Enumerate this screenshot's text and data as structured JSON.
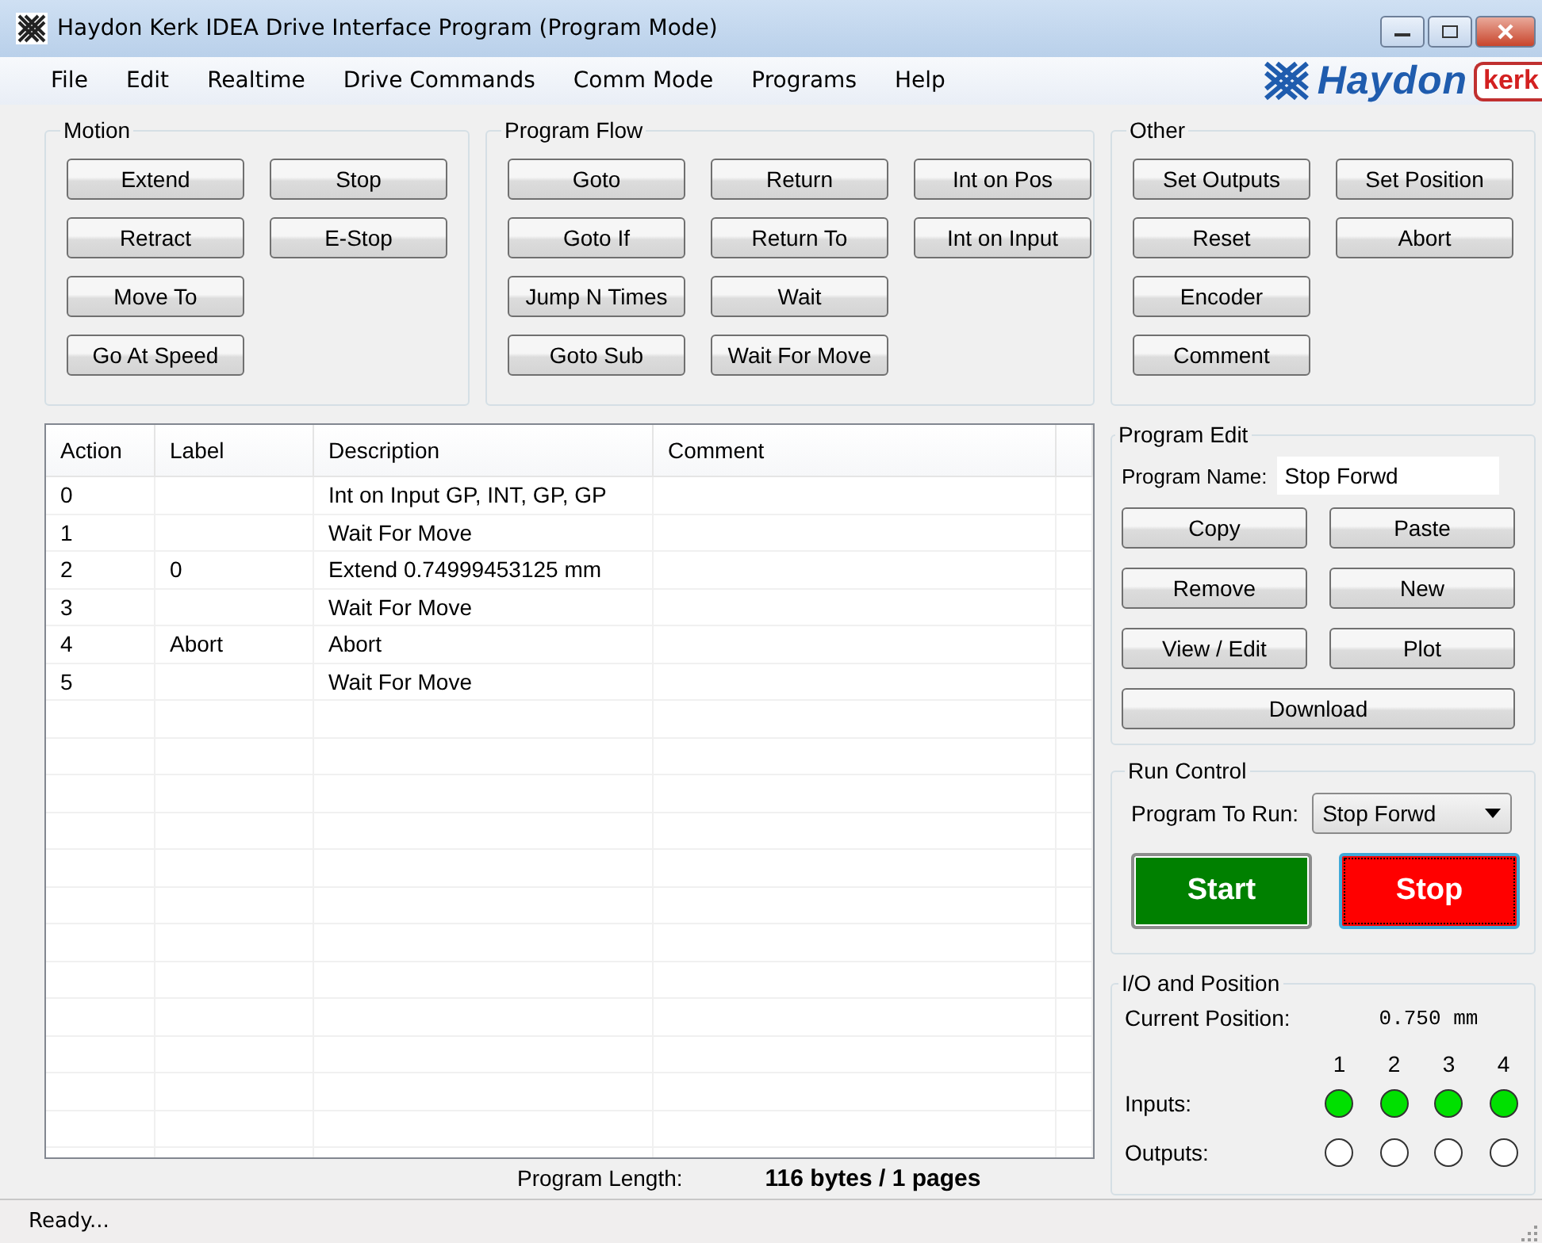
{
  "window": {
    "title": "Haydon Kerk IDEA Drive Interface Program (Program Mode)"
  },
  "menu": [
    "File",
    "Edit",
    "Realtime",
    "Drive Commands",
    "Comm Mode",
    "Programs",
    "Help"
  ],
  "logo": {
    "brand": "Haydon",
    "badge": "kerk"
  },
  "motion": {
    "title": "Motion",
    "rows": [
      [
        "Extend",
        "Stop"
      ],
      [
        "Retract",
        "E-Stop"
      ],
      [
        "Move To"
      ],
      [
        "Go At Speed"
      ]
    ]
  },
  "program_flow": {
    "title": "Program Flow",
    "rows": [
      [
        "Goto",
        "Return",
        "Int on Pos"
      ],
      [
        "Goto If",
        "Return To",
        "Int on Input"
      ],
      [
        "Jump N Times",
        "Wait"
      ],
      [
        "Goto Sub",
        "Wait For Move"
      ]
    ]
  },
  "other": {
    "title": "Other",
    "rows": [
      [
        "Set Outputs",
        "Set Position"
      ],
      [
        "Reset",
        "Abort"
      ],
      [
        "Encoder"
      ],
      [
        "Comment"
      ]
    ]
  },
  "table": {
    "columns": [
      "Action",
      "Label",
      "Description",
      "Comment"
    ],
    "rows": [
      {
        "action": "0",
        "description": "Int on Input GP, INT, GP, GP"
      },
      {
        "action": "1",
        "description": "Wait For Move"
      },
      {
        "action": "2",
        "label": "0",
        "description": "Extend 0.74999453125 mm"
      },
      {
        "action": "3",
        "description": "Wait For Move"
      },
      {
        "action": "4",
        "label": "Abort",
        "description": "Abort"
      },
      {
        "action": "5",
        "description": "Wait For Move"
      }
    ]
  },
  "program_length": {
    "label": "Program Length:",
    "value": "116 bytes / 1 pages"
  },
  "program_edit": {
    "title": "Program Edit",
    "name_label": "Program Name:",
    "name_value": "Stop Forwd",
    "rows": [
      [
        "Copy",
        "Paste"
      ],
      [
        "Remove",
        "New"
      ],
      [
        "View / Edit",
        "Plot"
      ],
      [
        "Download"
      ]
    ]
  },
  "run_control": {
    "title": "Run Control",
    "program_label": "Program To Run:",
    "program_value": "Stop Forwd",
    "buttons": [
      {
        "label": "Start",
        "kind": "start",
        "focused": false
      },
      {
        "label": "Stop",
        "kind": "stop",
        "focused": true
      }
    ]
  },
  "io": {
    "title": "I/O and Position",
    "position_label": "Current Position:",
    "position_value": "0.750 mm",
    "channels": [
      "1",
      "2",
      "3",
      "4"
    ],
    "inputs": {
      "label": "Inputs:",
      "leds": [
        {
          "on": true
        },
        {
          "on": true
        },
        {
          "on": true
        },
        {
          "on": true
        }
      ]
    },
    "outputs": {
      "label": "Outputs:",
      "leds": [
        {
          "on": false
        },
        {
          "on": false
        },
        {
          "on": false
        },
        {
          "on": false
        }
      ]
    }
  },
  "status_bar": {
    "text": "Ready..."
  }
}
